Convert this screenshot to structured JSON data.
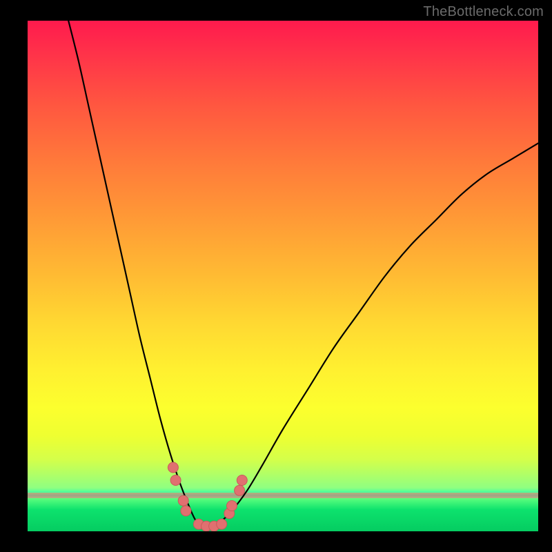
{
  "watermark": "TheBottleneck.com",
  "colors": {
    "background": "#000000",
    "curve": "#000000",
    "marker_fill": "#e07070",
    "marker_stroke": "#c85a5a",
    "gradient_top": "#ff1a4d",
    "gradient_mid": "#fff030",
    "gradient_bottom": "#05cc61"
  },
  "chart_data": {
    "type": "line",
    "title": "",
    "xlabel": "",
    "ylabel": "",
    "xlim": [
      0,
      100
    ],
    "ylim": [
      0,
      100
    ],
    "grid": false,
    "legend": false,
    "annotations": [
      "TheBottleneck.com"
    ],
    "series": [
      {
        "name": "left-branch",
        "x": [
          8,
          10,
          12,
          14,
          16,
          18,
          20,
          22,
          24,
          26,
          28,
          30,
          32,
          33
        ],
        "values": [
          100,
          92,
          83,
          74,
          65,
          56,
          47,
          38,
          30,
          22,
          15,
          9,
          4,
          2
        ]
      },
      {
        "name": "right-branch",
        "x": [
          38,
          40,
          43,
          46,
          50,
          55,
          60,
          65,
          70,
          75,
          80,
          85,
          90,
          95,
          100
        ],
        "values": [
          2,
          4,
          8,
          13,
          20,
          28,
          36,
          43,
          50,
          56,
          61,
          66,
          70,
          73,
          76
        ]
      },
      {
        "name": "valley-floor",
        "x": [
          33,
          34,
          35,
          36,
          37,
          38
        ],
        "values": [
          2,
          1,
          0.6,
          0.6,
          1,
          2
        ]
      }
    ],
    "markers": [
      {
        "x": 28.5,
        "y": 12.5
      },
      {
        "x": 29,
        "y": 10
      },
      {
        "x": 30.5,
        "y": 6
      },
      {
        "x": 31,
        "y": 4
      },
      {
        "x": 33.5,
        "y": 1.4
      },
      {
        "x": 35,
        "y": 1
      },
      {
        "x": 36.5,
        "y": 1
      },
      {
        "x": 38,
        "y": 1.4
      },
      {
        "x": 39.5,
        "y": 3.5
      },
      {
        "x": 40,
        "y": 5
      },
      {
        "x": 41.5,
        "y": 8
      },
      {
        "x": 42,
        "y": 10
      }
    ]
  }
}
